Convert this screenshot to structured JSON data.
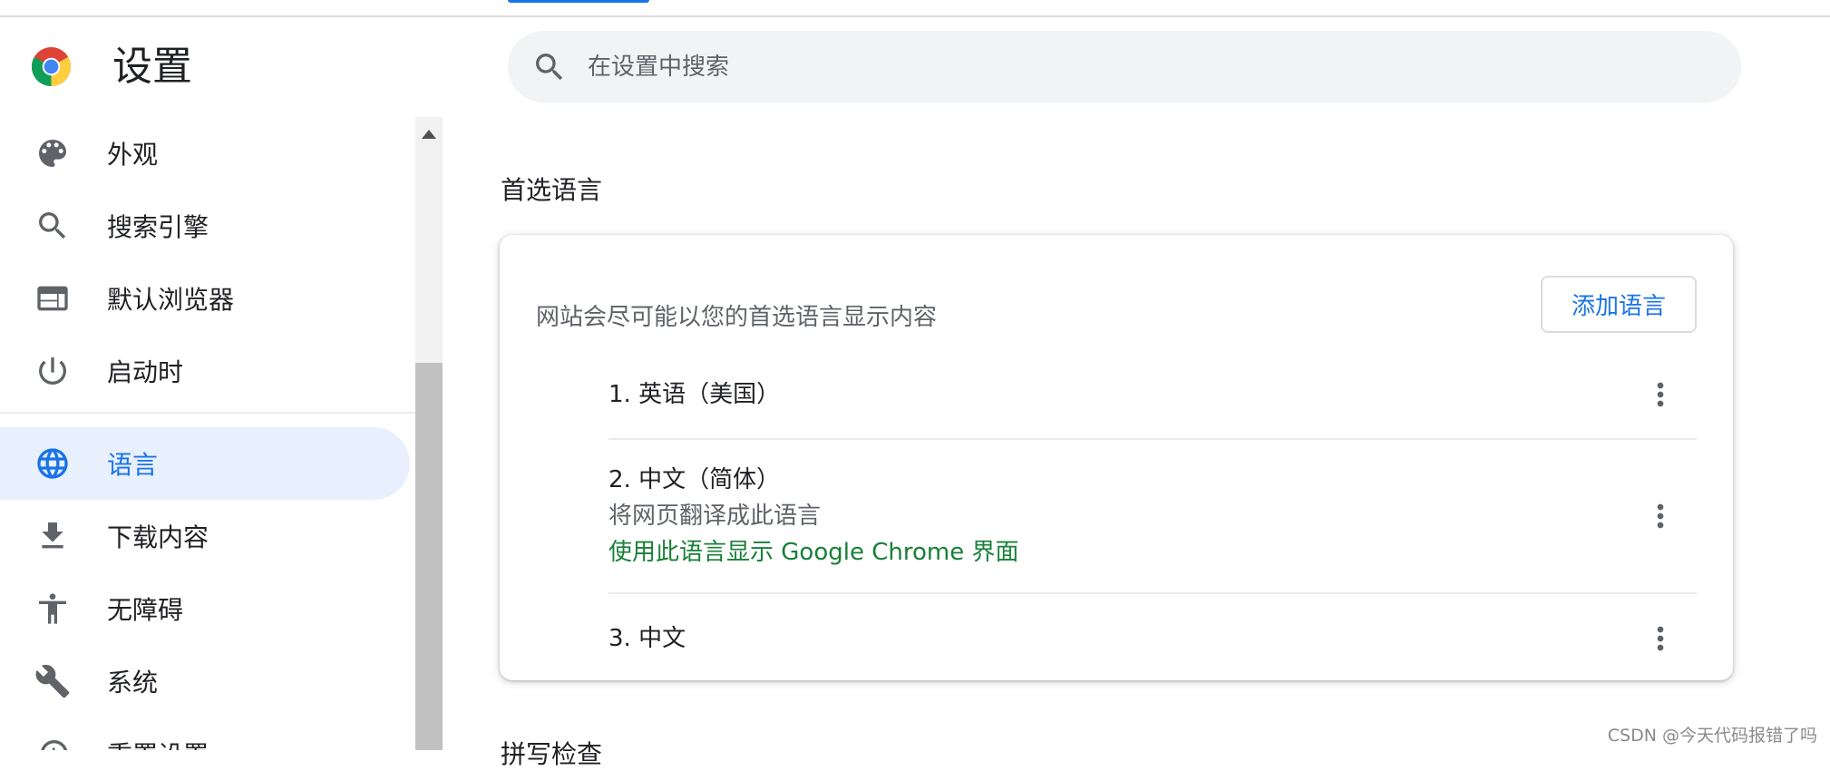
{
  "header": {
    "title": "设置",
    "search_placeholder": "在设置中搜索"
  },
  "sidebar": {
    "items": [
      {
        "label": "外观",
        "icon": "palette-icon"
      },
      {
        "label": "搜索引擎",
        "icon": "search-icon"
      },
      {
        "label": "默认浏览器",
        "icon": "browser-window-icon"
      },
      {
        "label": "启动时",
        "icon": "power-icon"
      },
      {
        "label": "语言",
        "icon": "globe-icon",
        "active": true
      },
      {
        "label": "下载内容",
        "icon": "download-icon"
      },
      {
        "label": "无障碍",
        "icon": "accessibility-icon"
      },
      {
        "label": "系统",
        "icon": "wrench-icon"
      },
      {
        "label": "重置设置",
        "icon": "reset-icon"
      }
    ]
  },
  "main": {
    "section_title": "首选语言",
    "card": {
      "description": "网站会尽可能以您的首选语言显示内容",
      "add_button": "添加语言",
      "languages": [
        {
          "label": "1. 英语（美国）"
        },
        {
          "label": "2. 中文（简体）",
          "sub": "将网页翻译成此语言",
          "ui_note": "使用此语言显示 Google Chrome 界面"
        },
        {
          "label": "3. 中文"
        }
      ]
    },
    "next_section_title": "拼写检查"
  },
  "watermark": "CSDN @今天代码报错了吗",
  "colors": {
    "accent": "#1a73e8",
    "active_bg": "#e8f0fe",
    "green": "#188038",
    "text_secondary": "#5f6368"
  }
}
